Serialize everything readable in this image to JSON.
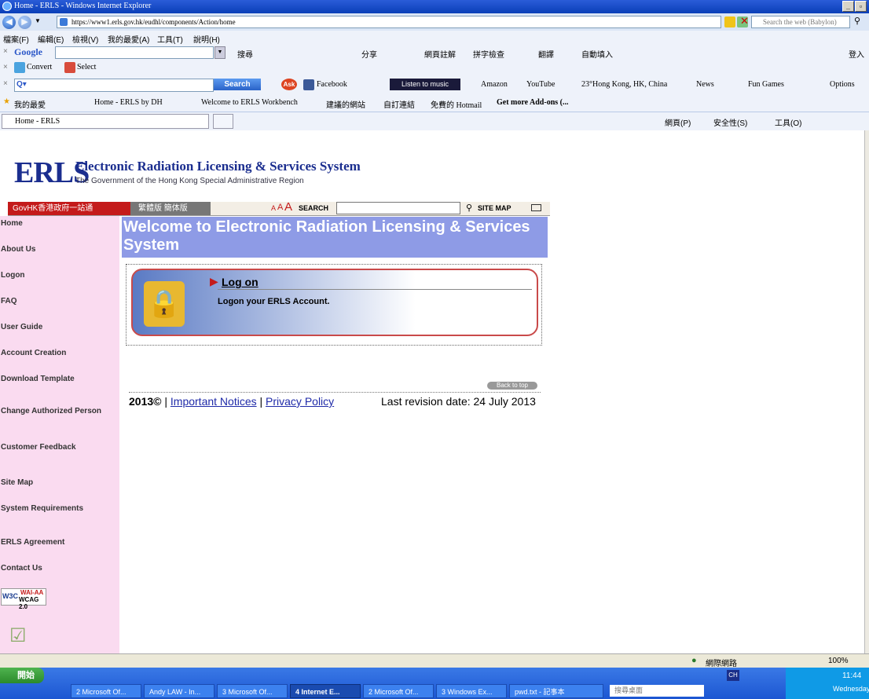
{
  "window": {
    "title": "Home - ERLS - Windows Internet Explorer"
  },
  "address": {
    "url": "https://www1.erls.gov.hk/eudhl/components/Action/home",
    "search_placeholder": "Search the web (Babylon)"
  },
  "menu": [
    "檔案(F)",
    "編輯(E)",
    "檢視(V)",
    "我的最愛(A)",
    "工具(T)",
    "說明(H)"
  ],
  "google_toolbar": {
    "brand": "Google",
    "search": "搜尋",
    "share": "分享",
    "annotate": "網頁註解",
    "spellcheck": "拼字檢查",
    "translate": "翻譯",
    "autofill": "自動填入",
    "login": "登入"
  },
  "convert_toolbar": {
    "convert": "Convert",
    "select": "Select"
  },
  "ask_toolbar": {
    "search_button": "Search",
    "facebook": "Facebook",
    "music": "Listen to music",
    "amazon": "Amazon",
    "youtube": "YouTube",
    "weather": "23°Hong Kong, HK, China",
    "news": "News",
    "games": "Fun Games",
    "options": "Options"
  },
  "favorites_bar": {
    "favorites": "我的最愛",
    "items": [
      "Home - ERLS by DH",
      "Welcome to ERLS Workbench",
      "建議的網站",
      "自訂連結",
      "免費的 Hotmail",
      "Get more Add-ons (..."
    ]
  },
  "tab": {
    "title": "Home - ERLS"
  },
  "command_bar": {
    "page": "網頁(P)",
    "safety": "安全性(S)",
    "tools": "工具(O)"
  },
  "page": {
    "logo": "ERLS",
    "system_name": "Electronic Radiation Licensing & Services System",
    "government": "The Government of the Hong Kong Special Administrative Region",
    "govhk": "GovHK香港政府一站通",
    "languages": "繁體版  簡体版",
    "font_sizes": [
      "A",
      "A",
      "A"
    ],
    "search_label": "SEARCH",
    "site_map": "SITE MAP",
    "welcome": "Welcome to Electronic Radiation Licensing & Services System",
    "logon_title": "Log on",
    "logon_desc": "Logon your ERLS Account.",
    "back_to_top": "Back to top",
    "footer_year": "2013©",
    "important_notices": "Important Notices",
    "privacy_policy": "Privacy Policy",
    "last_revision": "Last revision date: 24 July 2013",
    "nav": [
      "Home",
      "About Us",
      "Logon",
      "FAQ",
      "User Guide",
      "Account Creation",
      "Download Template",
      "Change Authorized Person",
      "Customer Feedback",
      "Site Map",
      "System Requirements",
      "ERLS Agreement",
      "Contact Us"
    ],
    "wai_badge": {
      "w3c": "W3C",
      "top": "WAI-AA",
      "bottom": "WCAG 2.0"
    }
  },
  "status": {
    "zone": "網際網路",
    "zoom": "100%"
  },
  "taskbar": {
    "start": "開始",
    "tasks": [
      "2 Microsoft Of...",
      "Andy LAW - In...",
      "3 Microsoft Of...",
      "4 Internet E...",
      "2 Microsoft Of...",
      "3 Windows Ex...",
      "pwd.txt - 記事本"
    ],
    "desktop_search": "搜尋桌面",
    "lang": "CH",
    "time": "11:44",
    "day": "Wednesday"
  }
}
